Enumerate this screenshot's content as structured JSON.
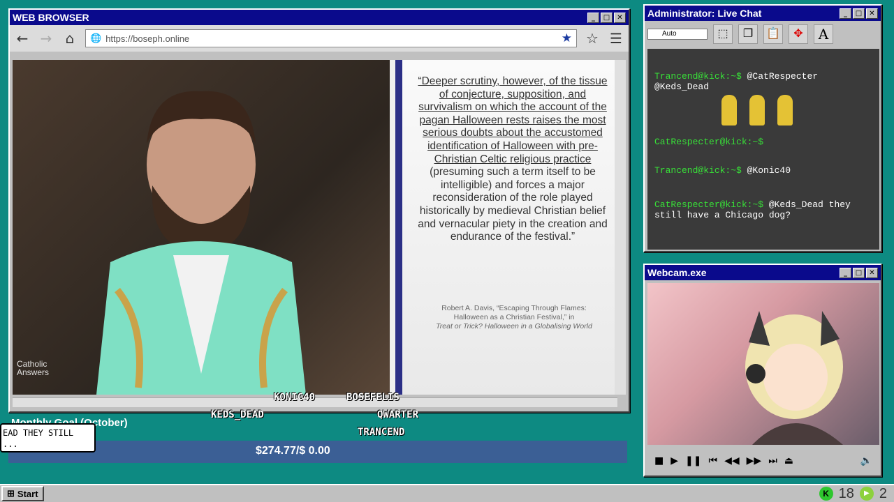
{
  "browser": {
    "title": "WEB BROWSER",
    "url": "https://boseph.online"
  },
  "video": {
    "logo_line1": "Catholic",
    "logo_line2": "Answers",
    "quote_parts": [
      "“Deeper scrutiny, however, of the tissue of conjecture, supposition, and survivalism on which the account of the pagan Halloween rests raises the most serious doubts about the accustomed identification of Halloween with pre-Christian Celtic religious practice",
      " (presuming such a term itself to be intelligible) and forces a major reconsideration of the role played historically by medieval Christian belief and vernacular piety in the creation and endurance of the festival.”"
    ],
    "citation_line1": "Robert A. Davis, “Escaping Through Flames:",
    "citation_line2": "Halloween as a Christian Festival,” in",
    "citation_line3": "Treat or Trick? Halloween in a Globalising World"
  },
  "chat": {
    "title": "Administrator: Live Chat",
    "select_value": "Auto",
    "messages": [
      {
        "user": "Trancend@kick:~$",
        "text": " @CatRespecter @Keds_Dead"
      },
      {
        "user": "CatRespecter@kick:~$",
        "text": ""
      },
      {
        "user": "Trancend@kick:~$",
        "text": " @Konic40"
      },
      {
        "user": "CatRespecter@kick:~$",
        "text": " @Keds_Dead they still have a Chicago dog?"
      }
    ]
  },
  "webcam": {
    "title": "Webcam.exe"
  },
  "overlay": {
    "monthly_goal": "Monthly Goal (October)",
    "goal_amount": "$274.77/$ 0.00",
    "bubble_text": "EAD THEY STILL ...",
    "names": [
      "KONIC40",
      "BOSEFELIS",
      "KEDS_DEAD",
      "QWARTER",
      "TRANCEND"
    ]
  },
  "taskbar": {
    "start_label": "Start",
    "kick_count": "18",
    "other_count": "2"
  }
}
